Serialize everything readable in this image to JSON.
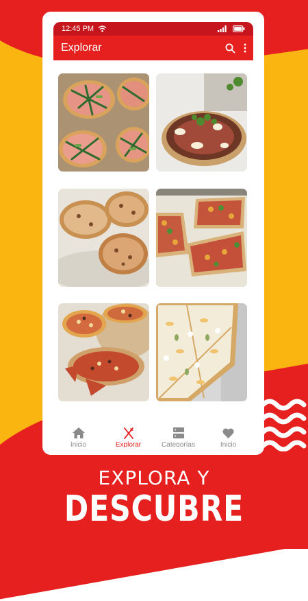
{
  "status_bar": {
    "time": "12:45 PM"
  },
  "app_bar": {
    "title": "Explorar"
  },
  "grid": {
    "items": [
      {
        "icon": "pizza-prosciutto-arugula-image"
      },
      {
        "icon": "pizza-prosciutto-herbs-image"
      },
      {
        "icon": "pizza-cheese-mushroom-image"
      },
      {
        "icon": "flatbread-tomato-basil-image"
      },
      {
        "icon": "pizza-minis-salami-image"
      },
      {
        "icon": "white-pizza-pear-image"
      }
    ]
  },
  "bottom_nav": {
    "items": [
      {
        "label": "Inicio",
        "icon": "home-icon",
        "active": false
      },
      {
        "label": "Explorar",
        "icon": "fork-knife-icon",
        "active": true
      },
      {
        "label": "Categorías",
        "icon": "categories-icon",
        "active": false
      },
      {
        "label": "Inicio",
        "icon": "heart-icon",
        "active": false
      }
    ]
  },
  "promo": {
    "line1": "EXPLORA Y",
    "line2": "DESCUBRE"
  },
  "colors": {
    "brand_red": "#e5201e",
    "status_red": "#c7151d",
    "yellow": "#fbb511"
  }
}
